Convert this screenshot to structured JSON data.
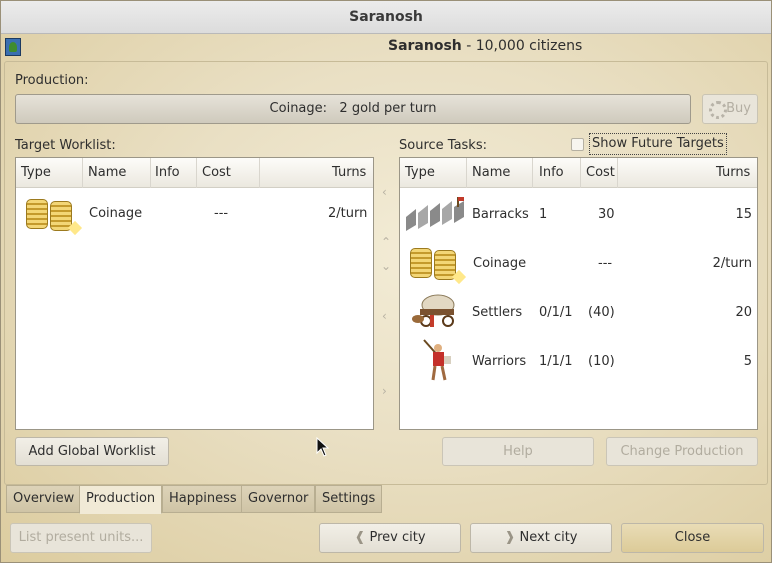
{
  "window": {
    "title": "Saranosh"
  },
  "header": {
    "city": "Saranosh",
    "citizens": " - 10,000 citizens"
  },
  "production": {
    "label": "Production:",
    "current": "Coinage:   2 gold per turn",
    "buy_label": "Buy"
  },
  "worklist": {
    "label": "Target Worklist:",
    "columns": [
      "Type",
      "Name",
      "Info",
      "Cost",
      "Turns"
    ],
    "rows": [
      {
        "icon": "coinage-icon",
        "name": "Coinage",
        "info": "",
        "cost": "---",
        "turns": "2/turn"
      }
    ]
  },
  "source": {
    "label": "Source Tasks:",
    "show_future_label": "Show Future Targets",
    "show_future_checked": false,
    "columns": [
      "Type",
      "Name",
      "Info",
      "Cost",
      "Turns"
    ],
    "rows": [
      {
        "icon": "barracks-icon",
        "name": "Barracks",
        "info": "1",
        "cost": "30",
        "turns": "15"
      },
      {
        "icon": "coinage-icon",
        "name": "Coinage",
        "info": "",
        "cost": "---",
        "turns": "2/turn"
      },
      {
        "icon": "settlers-icon",
        "name": "Settlers",
        "info": "0/1/1",
        "cost": "(40)",
        "turns": "20"
      },
      {
        "icon": "warriors-icon",
        "name": "Warriors",
        "info": "1/1/1",
        "cost": "(10)",
        "turns": "5"
      }
    ]
  },
  "buttons": {
    "add_global": "Add Global Worklist",
    "help": "Help",
    "change_production": "Change Production",
    "list_units": "List present units...",
    "prev_city": "Prev city",
    "next_city": "Next city",
    "close": "Close"
  },
  "tabs": [
    "Overview",
    "Production",
    "Happiness",
    "Governor",
    "Settings"
  ],
  "active_tab": "Production"
}
